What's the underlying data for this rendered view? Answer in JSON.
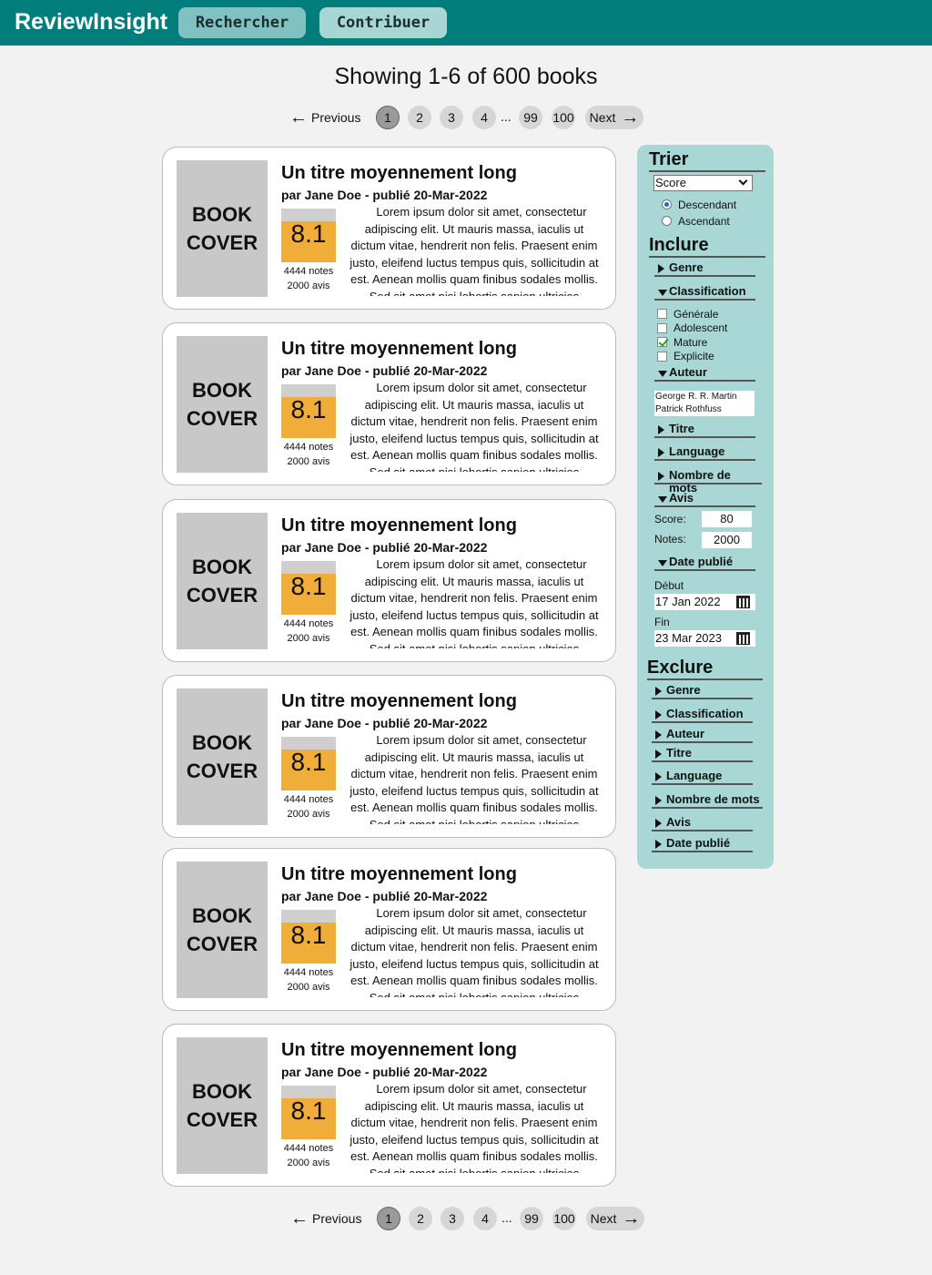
{
  "header": {
    "brand": "ReviewInsight",
    "tabs": [
      {
        "label": "Rechercher",
        "active": true
      },
      {
        "label": "Contribuer",
        "active": false
      }
    ],
    "accent": "#017d7b"
  },
  "results_summary": "Showing 1-6 of 600 books",
  "pagination": {
    "previous_label": "Previous",
    "next_label": "Next",
    "pages": [
      "1",
      "2",
      "3",
      "4",
      "99",
      "100"
    ],
    "ellipsis": "...",
    "current_page": "1"
  },
  "books": [
    {
      "title": "Un titre moyennement long",
      "byline": "par Jane Doe - publié 20-Mar-2022",
      "cover_text": [
        "BOOK",
        "COVER"
      ],
      "score": "8.1",
      "ratings": "4444 notes",
      "reviews": "2000 avis",
      "description": "Lorem ipsum dolor sit amet, consectetur adipiscing elit. Ut mauris massa, iaculis ut dictum vitae, hendrerit non felis. Praesent enim justo, eleifend luctus tempus quis, sollicitudin at est. Aenean mollis quam finibus sodales mollis. Sed sit amet nisi lobortis sapien ultricies"
    },
    {
      "title": "Un titre moyennement long",
      "byline": "par Jane Doe - publié 20-Mar-2022",
      "cover_text": [
        "BOOK",
        "COVER"
      ],
      "score": "8.1",
      "ratings": "4444 notes",
      "reviews": "2000 avis",
      "description": "Lorem ipsum dolor sit amet, consectetur adipiscing elit. Ut mauris massa, iaculis ut dictum vitae, hendrerit non felis. Praesent enim justo, eleifend luctus tempus quis, sollicitudin at est. Aenean mollis quam finibus sodales mollis. Sed sit amet nisi lobortis sapien ultricies"
    },
    {
      "title": "Un titre moyennement long",
      "byline": "par Jane Doe - publié 20-Mar-2022",
      "cover_text": [
        "BOOK",
        "COVER"
      ],
      "score": "8.1",
      "ratings": "4444 notes",
      "reviews": "2000 avis",
      "description": "Lorem ipsum dolor sit amet, consectetur adipiscing elit. Ut mauris massa, iaculis ut dictum vitae, hendrerit non felis. Praesent enim justo, eleifend luctus tempus quis, sollicitudin at est. Aenean mollis quam finibus sodales mollis. Sed sit amet nisi lobortis sapien ultricies"
    },
    {
      "title": "Un titre moyennement long",
      "byline": "par Jane Doe - publié 20-Mar-2022",
      "cover_text": [
        "BOOK",
        "COVER"
      ],
      "score": "8.1",
      "ratings": "4444 notes",
      "reviews": "2000 avis",
      "description": "Lorem ipsum dolor sit amet, consectetur adipiscing elit. Ut mauris massa, iaculis ut dictum vitae, hendrerit non felis. Praesent enim justo, eleifend luctus tempus quis, sollicitudin at est. Aenean mollis quam finibus sodales mollis. Sed sit amet nisi lobortis sapien ultricies"
    },
    {
      "title": "Un titre moyennement long",
      "byline": "par Jane Doe - publié 20-Mar-2022",
      "cover_text": [
        "BOOK",
        "COVER"
      ],
      "score": "8.1",
      "ratings": "4444 notes",
      "reviews": "2000 avis",
      "description": "Lorem ipsum dolor sit amet, consectetur adipiscing elit. Ut mauris massa, iaculis ut dictum vitae, hendrerit non felis. Praesent enim justo, eleifend luctus tempus quis, sollicitudin at est. Aenean mollis quam finibus sodales mollis. Sed sit amet nisi lobortis sapien ultricies"
    },
    {
      "title": "Un titre moyennement long",
      "byline": "par Jane Doe - publié 20-Mar-2022",
      "cover_text": [
        "BOOK",
        "COVER"
      ],
      "score": "8.1",
      "ratings": "4444 notes",
      "reviews": "2000 avis",
      "description": "Lorem ipsum dolor sit amet, consectetur adipiscing elit. Ut mauris massa, iaculis ut dictum vitae, hendrerit non felis. Praesent enim justo, eleifend luctus tempus quis, sollicitudin at est. Aenean mollis quam finibus sodales mollis. Sed sit amet nisi lobortis sapien ultricies"
    }
  ],
  "sidebar": {
    "sort": {
      "heading": "Trier",
      "selected": "Score",
      "options": [
        {
          "label": "Descendant",
          "checked": true
        },
        {
          "label": "Ascendant",
          "checked": false
        }
      ]
    },
    "include": {
      "heading": "Inclure",
      "genre": "Genre",
      "classification": "Classification",
      "classification_options": [
        {
          "label": "Générale",
          "checked": false
        },
        {
          "label": "Adolescent",
          "checked": false
        },
        {
          "label": "Mature",
          "checked": true
        },
        {
          "label": "Explicite",
          "checked": false
        }
      ],
      "author": "Auteur",
      "authors_value": [
        "George R. R. Martin",
        "Patrick Rothfuss"
      ],
      "title": "Titre",
      "language": "Language",
      "word_count": "Nombre de mots",
      "reviews": "Avis",
      "score_label": "Score:",
      "score_value": "80",
      "ratings_label": "Notes:",
      "ratings_value": "2000",
      "date": "Date publié",
      "start_label": "Début",
      "start_value": "17 Jan 2022",
      "end_label": "Fin",
      "end_value": "23 Mar 2023"
    },
    "exclude": {
      "heading": "Exclure",
      "items": [
        "Genre",
        "Classification",
        "Auteur",
        "Titre",
        "Language",
        "Nombre de mots",
        "Avis",
        "Date publié"
      ]
    }
  },
  "colors": {
    "sidebar_bg": "#a8d7d6",
    "score_bg": "#f0ad3a",
    "cover_bg": "#c8c8c8"
  }
}
